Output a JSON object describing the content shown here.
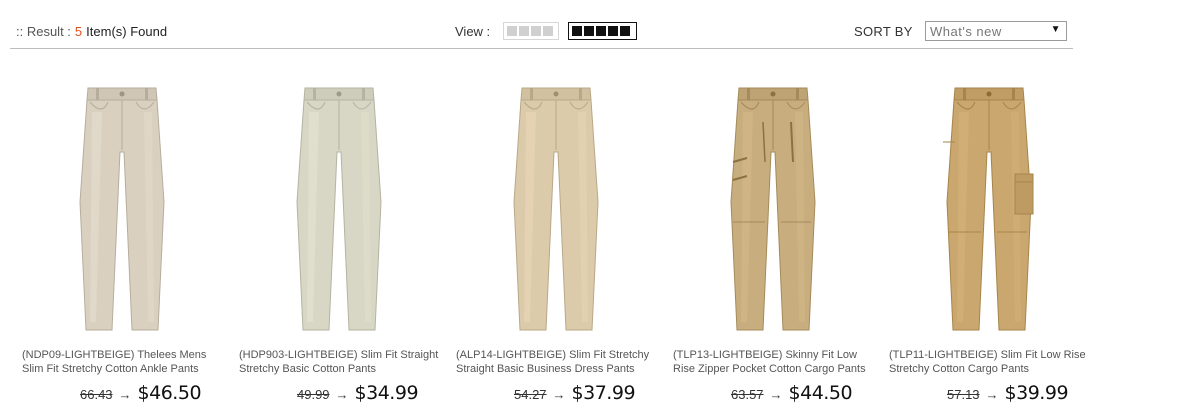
{
  "toolbar": {
    "result_prefix": ":: Result :",
    "result_count": "5",
    "result_suffix": "Item(s) Found",
    "view_label": "View :",
    "sort_label": "SORT BY",
    "sort_value": "What's new"
  },
  "products": [
    {
      "name": "(NDP09-LIGHTBEIGE) Thelees Mens Slim Fit Stretchy Cotton Ankle Pants",
      "old_price": "66.43",
      "new_price": "$46.50",
      "color": "#d9d0c0"
    },
    {
      "name": "(HDP903-LIGHTBEIGE) Slim Fit Straight Stretchy Basic Cotton Pants",
      "old_price": "49.99",
      "new_price": "$34.99",
      "color": "#d8d6c4"
    },
    {
      "name": "(ALP14-LIGHTBEIGE) Slim Fit Stretchy Straight Basic Business Dress Pants",
      "old_price": "54.27",
      "new_price": "$37.99",
      "color": "#dccbaa"
    },
    {
      "name": "(TLP13-LIGHTBEIGE) Skinny Fit Low Rise Zipper Pocket Cotton Cargo Pants",
      "old_price": "63.57",
      "new_price": "$44.50",
      "color": "#c8ad7e"
    },
    {
      "name": "(TLP11-LIGHTBEIGE) Slim Fit Low Rise Stretchy Cotton Cargo Pants",
      "old_price": "57.13",
      "new_price": "$39.99",
      "color": "#c9a76e"
    }
  ]
}
